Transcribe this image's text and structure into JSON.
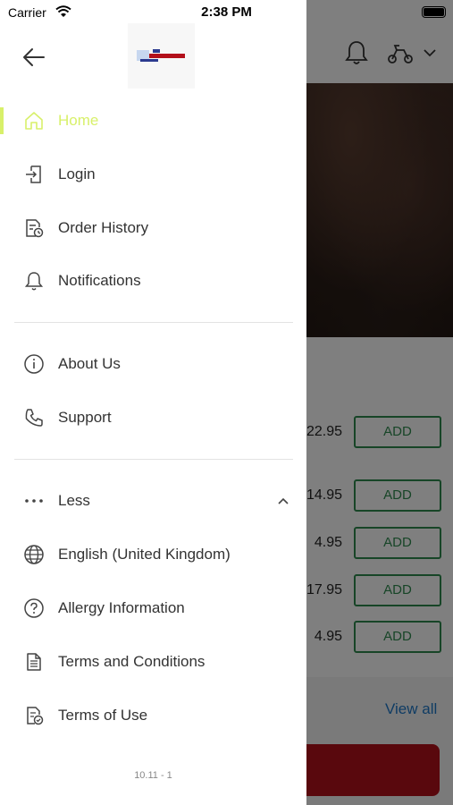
{
  "status_bar": {
    "carrier": "Carrier",
    "time": "2:38 PM"
  },
  "drawer": {
    "logo_alt": "restaurant-logo",
    "primary_items": [
      {
        "label": "Home",
        "icon": "home-icon",
        "active": true
      },
      {
        "label": "Login",
        "icon": "login-icon"
      },
      {
        "label": "Order History",
        "icon": "order-history-icon"
      },
      {
        "label": "Notifications",
        "icon": "bell-icon"
      }
    ],
    "secondary_items": [
      {
        "label": "About Us",
        "icon": "info-icon"
      },
      {
        "label": "Support",
        "icon": "phone-icon"
      }
    ],
    "more_toggle": {
      "label": "Less",
      "icon": "more-dots-icon",
      "expanded": true
    },
    "extra_items": [
      {
        "label": "English (United Kingdom)",
        "icon": "globe-icon"
      },
      {
        "label": "Allergy Information",
        "icon": "question-icon"
      },
      {
        "label": "Terms and Conditions",
        "icon": "document-icon"
      },
      {
        "label": "Terms of Use",
        "icon": "document-check-icon"
      }
    ],
    "version": "10.11 - 1",
    "active_color": "#d8f06a"
  },
  "background": {
    "prices": [
      "22.95",
      "14.95",
      "4.95",
      "17.95",
      "4.95"
    ],
    "add_label": "ADD",
    "view_all": "View all",
    "accent_green": "#2e8b4f",
    "link_blue": "#1f78c8",
    "cta_red": "#b3101b"
  }
}
